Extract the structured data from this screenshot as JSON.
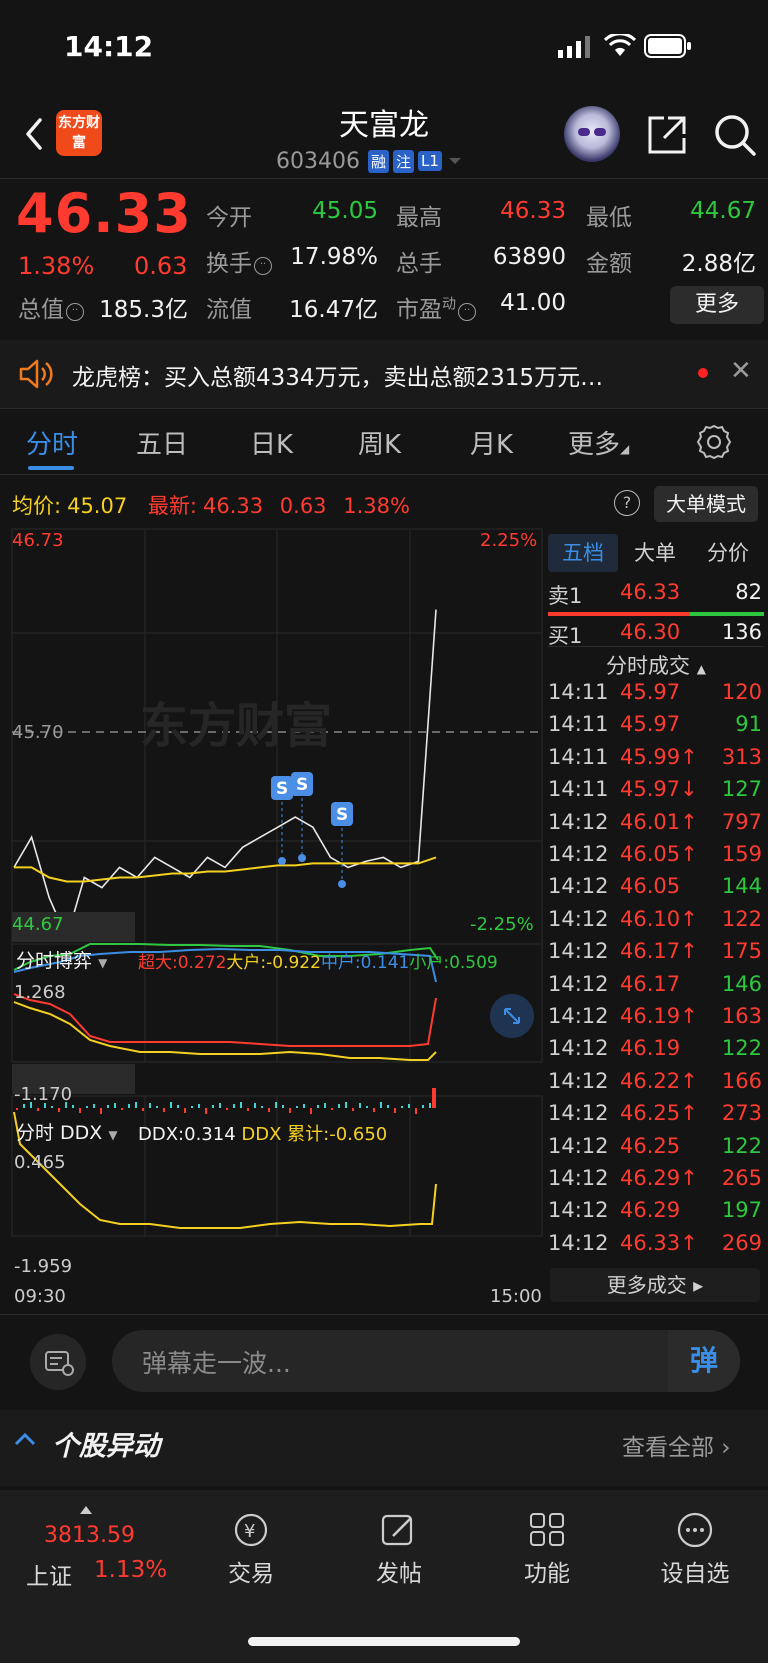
{
  "status_bar": {
    "time": "14:12"
  },
  "header": {
    "title": "天富龙",
    "code": "603406",
    "tags": [
      "融",
      "注",
      "L1"
    ],
    "logo_text": "东方财富"
  },
  "quote": {
    "price": "46.33",
    "change_pct": "1.38%",
    "change": "0.63",
    "open_label": "今开",
    "open": "45.05",
    "high_label": "最高",
    "high": "46.33",
    "low_label": "最低",
    "low": "44.67",
    "turnover_label": "换手",
    "turnover": "17.98%",
    "volume_label": "总手",
    "volume": "63890",
    "amount_label": "金额",
    "amount": "2.88亿",
    "mktcap_label": "总值",
    "mktcap": "185.3亿",
    "float_label": "流值",
    "float": "16.47亿",
    "pe_label": "市盈",
    "pe_sup": "动",
    "pe": "41.00",
    "more": "更多"
  },
  "notice": {
    "text": "龙虎榜：买入总额4334万元，卖出总额2315万元…"
  },
  "tabs": [
    "分时",
    "五日",
    "日K",
    "周K",
    "月K",
    "更多"
  ],
  "avg_row": {
    "avg_label": "均价:",
    "avg": "45.07",
    "latest_label": "最新:",
    "latest": "46.33",
    "chg": "0.63",
    "pct": "1.38%",
    "bigorder": "大单模式"
  },
  "chart": {
    "y_top": "46.73",
    "y_mid": "45.70",
    "y_bot": "44.67",
    "pct_top": "2.25%",
    "pct_bot": "-2.25%",
    "watermark": "东方财富",
    "sub1_title": "分时博弈",
    "sub1_chaoda": "超大:0.272",
    "sub1_dahu": "大户:-0.922",
    "sub1_zhonghu": "中户:0.141",
    "sub1_xiaohu": "小户:0.509",
    "sub1_top": "1.268",
    "sub1_bot": "-1.170",
    "sub2_title": "分时 DDX",
    "sub2_ddx": "DDX:0.314",
    "sub2_cum": "DDX 累计:-0.650",
    "sub2_top": "0.465",
    "sub2_bot": "-1.959",
    "x_start": "09:30",
    "x_end": "15:00",
    "marker": "S"
  },
  "chart_data": {
    "type": "line",
    "x_range": [
      "09:30",
      "15:00"
    ],
    "ylim": [
      44.67,
      46.73
    ],
    "reference": 45.7,
    "pct_range": [
      "-2.25%",
      "2.25%"
    ],
    "series": [
      {
        "name": "价格",
        "values": [
          45.05,
          45.2,
          44.9,
          44.7,
          45.0,
          44.95,
          45.05,
          45.0,
          45.1,
          45.05,
          45.0,
          45.1,
          45.05,
          45.15,
          45.2,
          45.25,
          45.3,
          45.25,
          45.1,
          45.05,
          45.08,
          45.1,
          45.05,
          45.08,
          46.33
        ]
      },
      {
        "name": "均价",
        "values": [
          45.05,
          45.05,
          45.0,
          44.98,
          44.98,
          44.99,
          45.0,
          45.0,
          45.01,
          45.02,
          45.02,
          45.03,
          45.03,
          45.04,
          45.05,
          45.06,
          45.06,
          45.07,
          45.07,
          45.07,
          45.07,
          45.07,
          45.07,
          45.07,
          45.1
        ]
      }
    ]
  },
  "right_panel": {
    "tabs": [
      "五档",
      "大单",
      "分价"
    ],
    "sell1": {
      "label": "卖1",
      "price": "46.33",
      "vol": "82"
    },
    "buy1": {
      "label": "买1",
      "price": "46.30",
      "vol": "136"
    },
    "fs_title": "分时成交",
    "trades": [
      {
        "t": "14:11",
        "p": "45.97",
        "v": "120",
        "pc": "red",
        "vc": "red"
      },
      {
        "t": "14:11",
        "p": "45.97",
        "v": "91",
        "pc": "red",
        "vc": "green"
      },
      {
        "t": "14:11",
        "p": "45.99↑",
        "v": "313",
        "pc": "red",
        "vc": "red"
      },
      {
        "t": "14:11",
        "p": "45.97↓",
        "v": "127",
        "pc": "red",
        "vc": "green"
      },
      {
        "t": "14:12",
        "p": "46.01↑",
        "v": "797",
        "pc": "red",
        "vc": "red"
      },
      {
        "t": "14:12",
        "p": "46.05↑",
        "v": "159",
        "pc": "red",
        "vc": "red"
      },
      {
        "t": "14:12",
        "p": "46.05",
        "v": "144",
        "pc": "red",
        "vc": "green"
      },
      {
        "t": "14:12",
        "p": "46.10↑",
        "v": "122",
        "pc": "red",
        "vc": "red"
      },
      {
        "t": "14:12",
        "p": "46.17↑",
        "v": "175",
        "pc": "red",
        "vc": "red"
      },
      {
        "t": "14:12",
        "p": "46.17",
        "v": "146",
        "pc": "red",
        "vc": "green"
      },
      {
        "t": "14:12",
        "p": "46.19↑",
        "v": "163",
        "pc": "red",
        "vc": "red"
      },
      {
        "t": "14:12",
        "p": "46.19",
        "v": "122",
        "pc": "red",
        "vc": "green"
      },
      {
        "t": "14:12",
        "p": "46.22↑",
        "v": "166",
        "pc": "red",
        "vc": "red"
      },
      {
        "t": "14:12",
        "p": "46.25↑",
        "v": "273",
        "pc": "red",
        "vc": "red"
      },
      {
        "t": "14:12",
        "p": "46.25",
        "v": "122",
        "pc": "red",
        "vc": "green"
      },
      {
        "t": "14:12",
        "p": "46.29↑",
        "v": "265",
        "pc": "red",
        "vc": "red"
      },
      {
        "t": "14:12",
        "p": "46.29",
        "v": "197",
        "pc": "red",
        "vc": "green"
      },
      {
        "t": "14:12",
        "p": "46.33↑",
        "v": "269",
        "pc": "red",
        "vc": "red"
      }
    ],
    "more_trades": "更多成交"
  },
  "comment": {
    "placeholder": "弹幕走一波...",
    "danmu": "弹"
  },
  "section": {
    "title": "个股异动",
    "more": "查看全部"
  },
  "bottom_nav": {
    "index_value": "3813.59",
    "index_name": "上证",
    "index_pct": "1.13%",
    "items": [
      "交易",
      "发帖",
      "功能",
      "设自选"
    ]
  },
  "colors": {
    "up": "#ff3b30",
    "down": "#2ec840",
    "accent": "#3a8ee6",
    "avg": "#f5d020"
  }
}
